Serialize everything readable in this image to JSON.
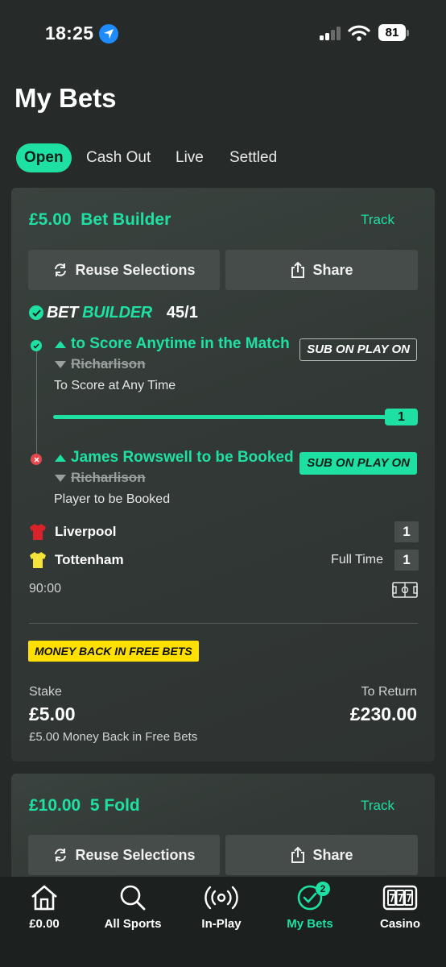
{
  "status_bar": {
    "time": "18:25",
    "battery": "81"
  },
  "page": {
    "title": "My Bets"
  },
  "tabs": [
    {
      "label": "Open",
      "active": true
    },
    {
      "label": "Cash Out",
      "active": false
    },
    {
      "label": "Live",
      "active": false
    },
    {
      "label": "Settled",
      "active": false
    }
  ],
  "bets": [
    {
      "stake_display": "£5.00",
      "bet_type": "Bet Builder",
      "track_label": "Track",
      "reuse_label": "Reuse Selections",
      "share_label": "Share",
      "builder_logo_1": "BET",
      "builder_logo_2": "BUILDER",
      "odds": "45/1",
      "legs": [
        {
          "selection": "to Score Anytime in the Match",
          "previous": "Richarlison",
          "market": "To Score at Any Time",
          "badge": "SUB ON PLAY ON",
          "status": "won",
          "progress": {
            "current": 1,
            "target": 1,
            "label": "1"
          }
        },
        {
          "selection": "James Rowswell to be Booked",
          "previous": "Richarlison",
          "market": "Player to be Booked",
          "badge": "SUB ON PLAY ON",
          "status": "lost"
        }
      ],
      "match": {
        "home": {
          "name": "Liverpool",
          "score": "1",
          "kit_color": "#d8232a"
        },
        "away": {
          "name": "Tottenham",
          "score": "1",
          "kit_color": "#f5e23a"
        },
        "period": "Full Time",
        "clock": "90:00"
      },
      "promo": "MONEY BACK IN FREE BETS",
      "stake_label": "Stake",
      "stake": "£5.00",
      "return_label": "To Return",
      "to_return": "£230.00",
      "money_back_note": "£5.00 Money Back in Free Bets"
    },
    {
      "stake_display": "£10.00",
      "bet_type": "5 Fold",
      "track_label": "Track",
      "reuse_label": "Reuse Selections",
      "share_label": "Share"
    }
  ],
  "bottom_nav": [
    {
      "label": "£0.00",
      "icon": "home-icon"
    },
    {
      "label": "All Sports",
      "icon": "search-icon"
    },
    {
      "label": "In-Play",
      "icon": "live-broadcast-icon"
    },
    {
      "label": "My Bets",
      "icon": "check-circle-icon",
      "badge": "2",
      "active": true
    },
    {
      "label": "Casino",
      "icon": "slot-machine-icon"
    }
  ],
  "colors": {
    "accent": "#1fe0a3",
    "background": "#262a28",
    "promo": "#ffe000",
    "lost": "#e5484d"
  }
}
